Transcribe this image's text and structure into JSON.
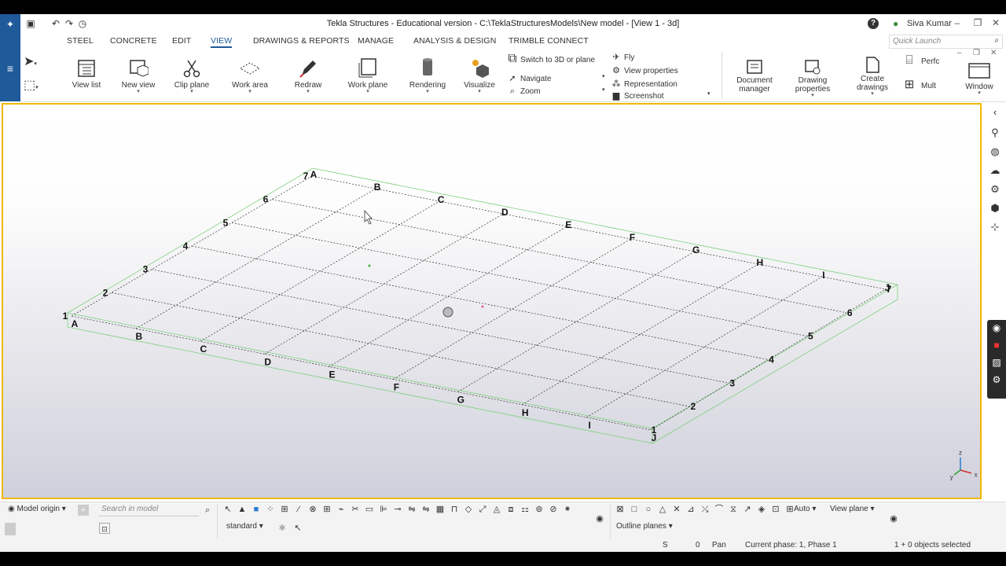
{
  "window": {
    "title": "Tekla Structures - Educational version - C:\\TeklaStructuresModels\\New model  - [View 1 - 3d]",
    "user": "Siva Kumar",
    "help_icon": "?",
    "accent": "#1f5a9a",
    "highlight": "#f0b800"
  },
  "menu": {
    "tabs": [
      "STEEL",
      "CONCRETE",
      "EDIT",
      "VIEW",
      "DRAWINGS & REPORTS",
      "MANAGE",
      "ANALYSIS & DESIGN",
      "TRIMBLE CONNECT"
    ],
    "active": "VIEW",
    "quick_launch_placeholder": "Quick Launch"
  },
  "ribbon": {
    "view_list": "View list",
    "new_view": "New view",
    "clip_plane": "Clip plane",
    "work_area": "Work area",
    "redraw": "Redraw",
    "work_plane": "Work plane",
    "rendering": "Rendering",
    "visualize": "Visualize",
    "switch_3d": "Switch to 3D or plane",
    "navigate": "Navigate",
    "zoom": "Zoom",
    "fly": "Fly",
    "view_properties": "View properties",
    "representation": "Representation",
    "screenshot": "Screenshot",
    "document_manager_1": "Document",
    "document_manager_2": "manager",
    "drawing_properties_1": "Drawing",
    "drawing_properties_2": "properties",
    "create_drawings_1": "Create",
    "create_drawings_2": "drawings",
    "perf": "Perfc",
    "mult": "Mult",
    "window": "Window"
  },
  "grid": {
    "letters": [
      "A",
      "B",
      "C",
      "D",
      "E",
      "F",
      "G",
      "H",
      "I",
      "J"
    ],
    "numbers": [
      "1",
      "2",
      "3",
      "4",
      "5",
      "6",
      "7"
    ],
    "axes": {
      "x": "x",
      "y": "y",
      "z": "z"
    }
  },
  "bottom": {
    "model_origin": "Model origin",
    "search_placeholder": "Search in model",
    "standard": "standard",
    "auto": "Auto",
    "view_plane": "View plane",
    "outline_planes": "Outline planes"
  },
  "status": {
    "s": "S",
    "zero": "0",
    "pan": "Pan",
    "phase": "Current phase: 1, Phase 1",
    "selected": "1 + 0 objects selected"
  }
}
